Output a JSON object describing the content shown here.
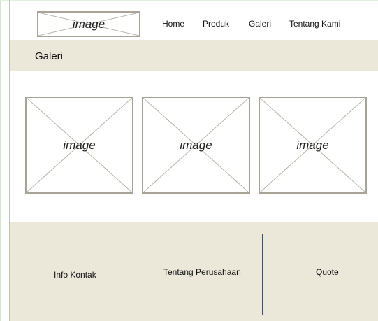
{
  "header": {
    "logo_label": "image",
    "nav": [
      "Home",
      "Produk",
      "Galeri",
      "Tentang Kami"
    ]
  },
  "page_title": "Galeri",
  "gallery": {
    "items": [
      "image",
      "image",
      "image"
    ]
  },
  "footer": {
    "links": [
      "Info Kontak",
      "Tentang Perusahaan",
      "Quote"
    ]
  },
  "colors": {
    "band_background": "#ebe8da",
    "placeholder_border": "#a8a397",
    "divider": "#3a4f7a"
  }
}
